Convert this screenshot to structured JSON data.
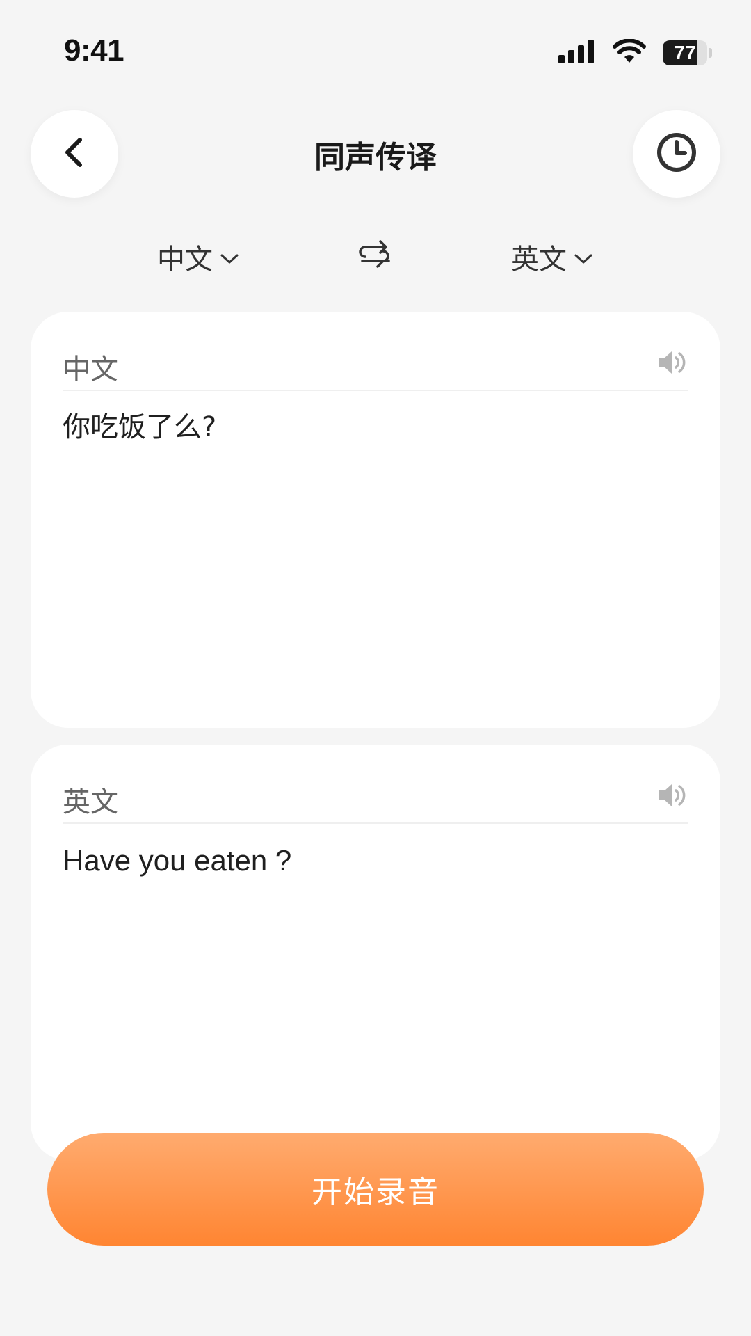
{
  "status_bar": {
    "time": "9:41",
    "battery_level": "77",
    "battery_fraction": 0.77
  },
  "header": {
    "title": "同声传译",
    "back_icon": "chevron-left-icon",
    "history_icon": "clock-icon"
  },
  "language_bar": {
    "source_language": "中文",
    "target_language": "英文",
    "dropdown_icon": "chevron-down-icon",
    "swap_icon": "swap-arrows-icon"
  },
  "source_card": {
    "language": "中文",
    "text": "你吃饭了么?",
    "speaker_icon": "speaker-icon"
  },
  "target_card": {
    "language": "英文",
    "text": "Have you eaten ?",
    "speaker_icon": "speaker-icon"
  },
  "record_button": {
    "label": "开始录音"
  },
  "colors": {
    "background": "#f5f5f5",
    "card": "#ffffff",
    "accent_top": "#ffab6f",
    "accent_bottom": "#ff8532",
    "muted_icon": "#b5b5b5"
  }
}
